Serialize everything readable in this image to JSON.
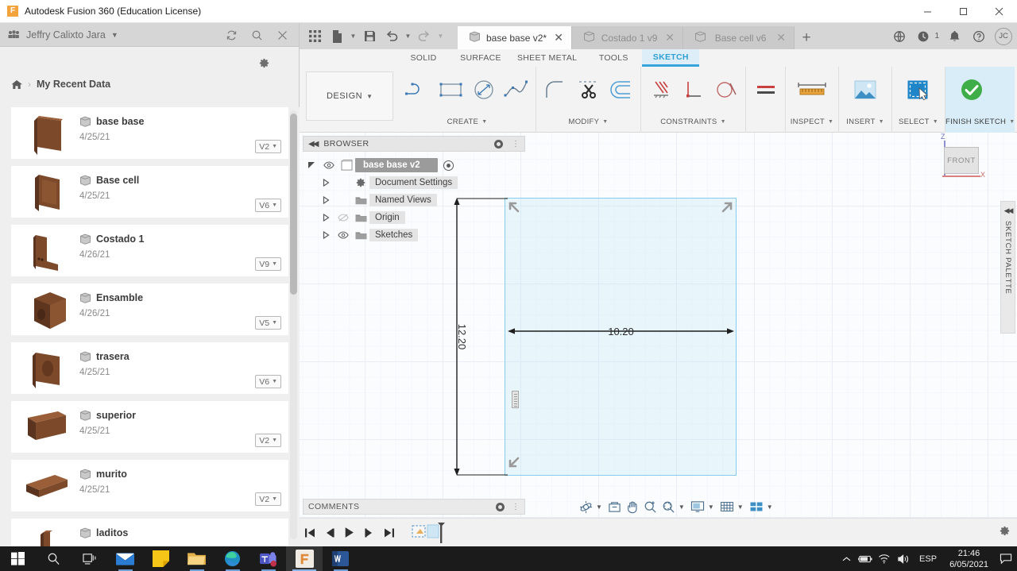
{
  "window": {
    "title": "Autodesk Fusion 360 (Education License)",
    "logo_letter": "F",
    "controls": {
      "minimize": "minimize-icon",
      "maximize": "maximize-icon",
      "close": "close-icon"
    }
  },
  "data_panel": {
    "user_name": "Jeffry Calixto Jara",
    "breadcrumb_home": "home-icon",
    "breadcrumb_separator": "›",
    "breadcrumb_current": "My Recent Data",
    "items": [
      {
        "name": "base base",
        "date": "4/25/21",
        "version": "V2"
      },
      {
        "name": "Base cell",
        "date": "4/25/21",
        "version": "V6"
      },
      {
        "name": "Costado 1",
        "date": "4/26/21",
        "version": "V9"
      },
      {
        "name": "Ensamble",
        "date": "4/26/21",
        "version": "V5"
      },
      {
        "name": "trasera",
        "date": "4/25/21",
        "version": "V6"
      },
      {
        "name": "superior",
        "date": "4/25/21",
        "version": "V2"
      },
      {
        "name": "murito",
        "date": "4/25/21",
        "version": "V2"
      },
      {
        "name": "laditos",
        "date": "",
        "version": ""
      }
    ]
  },
  "doc_tabs": [
    {
      "label": "base base v2*",
      "active": true
    },
    {
      "label": "Costado 1 v9",
      "active": false
    },
    {
      "label": "Base cell v6",
      "active": false
    }
  ],
  "tab_right": {
    "job_count": "1"
  },
  "avatar": {
    "initials": "JC"
  },
  "ribbon": {
    "workspace_label": "DESIGN",
    "tabs": [
      {
        "label": "SOLID",
        "active": false
      },
      {
        "label": "SURFACE",
        "active": false
      },
      {
        "label": "SHEET METAL",
        "active": false
      },
      {
        "label": "TOOLS",
        "active": false
      },
      {
        "label": "SKETCH",
        "active": true
      }
    ],
    "groups": [
      {
        "label": "CREATE",
        "has_caret": true
      },
      {
        "label": "MODIFY",
        "has_caret": true
      },
      {
        "label": "CONSTRAINTS",
        "has_caret": true
      },
      {
        "label": "",
        "has_caret": false
      },
      {
        "label": "INSPECT",
        "has_caret": true
      },
      {
        "label": "INSERT",
        "has_caret": true
      },
      {
        "label": "SELECT",
        "has_caret": true
      },
      {
        "label": "FINISH SKETCH",
        "has_caret": true
      }
    ]
  },
  "browser": {
    "panel_title": "BROWSER",
    "root": "base base v2",
    "nodes": [
      {
        "label": "Document Settings",
        "icon": "gear-icon",
        "eye": "none"
      },
      {
        "label": "Named Views",
        "icon": "folder-icon",
        "eye": "none"
      },
      {
        "label": "Origin",
        "icon": "folder-icon",
        "eye": "hidden"
      },
      {
        "label": "Sketches",
        "icon": "folder-icon",
        "eye": "visible"
      }
    ]
  },
  "canvas": {
    "dimension_horizontal": "10.20",
    "dimension_vertical": "12.20",
    "viewcube_face": "FRONT",
    "axis_z": "Z",
    "axis_x": "X",
    "sketch_palette_label": "SKETCH PALETTE"
  },
  "comments": {
    "label": "COMMENTS"
  },
  "taskbar": {
    "language": "ESP",
    "time": "21:46",
    "date": "6/05/2021"
  }
}
